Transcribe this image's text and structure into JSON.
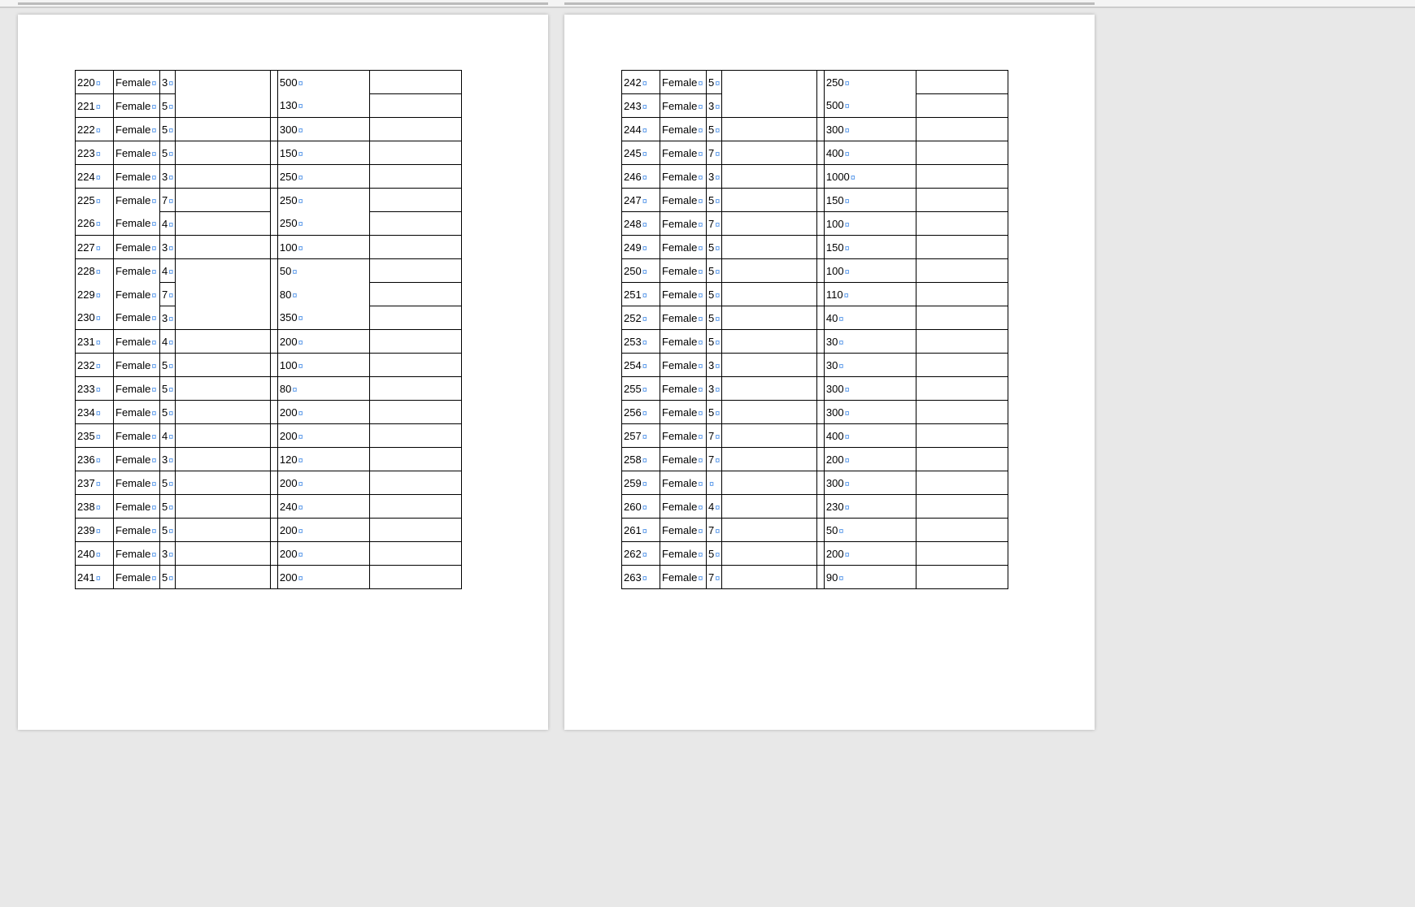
{
  "formatting_mark": "¤",
  "pages": [
    {
      "rows": [
        {
          "id": "220",
          "gender": "Female",
          "n": "3",
          "val": "500",
          "gaps": [
            3,
            4,
            5
          ]
        },
        {
          "id": "221",
          "gender": "Female",
          "n": "5",
          "val": "130"
        },
        {
          "id": "222",
          "gender": "Female",
          "n": "5",
          "val": "300"
        },
        {
          "id": "223",
          "gender": "Female",
          "n": "5",
          "val": "150"
        },
        {
          "id": "224",
          "gender": "Female",
          "n": "3",
          "val": "250"
        },
        {
          "id": "225",
          "gender": "Female",
          "n": "7",
          "val": "250",
          "gaps": [
            0,
            1,
            4,
            5
          ]
        },
        {
          "id": "226",
          "gender": "Female",
          "n": "4",
          "val": "250"
        },
        {
          "id": "227",
          "gender": "Female",
          "n": "3",
          "val": "100"
        },
        {
          "id": "228",
          "gender": "Female",
          "n": "4",
          "val": "50",
          "gaps": [
            0,
            1,
            3,
            4,
            5
          ]
        },
        {
          "id": "229",
          "gender": "Female",
          "n": "7",
          "val": "80",
          "gaps": [
            0,
            1,
            3,
            4,
            5
          ]
        },
        {
          "id": "230",
          "gender": "Female",
          "n": "3",
          "val": "350"
        },
        {
          "id": "231",
          "gender": "Female",
          "n": "4",
          "val": "200"
        },
        {
          "id": "232",
          "gender": "Female",
          "n": "5",
          "val": "100"
        },
        {
          "id": "233",
          "gender": "Female",
          "n": "5",
          "val": "80"
        },
        {
          "id": "234",
          "gender": "Female",
          "n": "5",
          "val": "200"
        },
        {
          "id": "235",
          "gender": "Female",
          "n": "4",
          "val": "200"
        },
        {
          "id": "236",
          "gender": "Female",
          "n": "3",
          "val": "120"
        },
        {
          "id": "237",
          "gender": "Female",
          "n": "5",
          "val": "200"
        },
        {
          "id": "238",
          "gender": "Female",
          "n": "5",
          "val": "240"
        },
        {
          "id": "239",
          "gender": "Female",
          "n": "5",
          "val": "200"
        },
        {
          "id": "240",
          "gender": "Female",
          "n": "3",
          "val": "200"
        },
        {
          "id": "241",
          "gender": "Female",
          "n": "5",
          "val": "200"
        }
      ]
    },
    {
      "rows": [
        {
          "id": "242",
          "gender": "Female",
          "n": "5",
          "val": "250",
          "gaps": [
            3,
            4,
            5
          ]
        },
        {
          "id": "243",
          "gender": "Female",
          "n": "3",
          "val": "500"
        },
        {
          "id": "244",
          "gender": "Female",
          "n": "5",
          "val": "300"
        },
        {
          "id": "245",
          "gender": "Female",
          "n": "7",
          "val": "400"
        },
        {
          "id": "246",
          "gender": "Female",
          "n": "3",
          "val": "1000"
        },
        {
          "id": "247",
          "gender": "Female",
          "n": "5",
          "val": "150"
        },
        {
          "id": "248",
          "gender": "Female",
          "n": "7",
          "val": "100"
        },
        {
          "id": "249",
          "gender": "Female",
          "n": "5",
          "val": "150"
        },
        {
          "id": "250",
          "gender": "Female",
          "n": "5",
          "val": "100"
        },
        {
          "id": "251",
          "gender": "Female",
          "n": "5",
          "val": "110"
        },
        {
          "id": "252",
          "gender": "Female",
          "n": "5",
          "val": "40",
          "gapsTop": [
            0,
            1
          ]
        },
        {
          "id": "253",
          "gender": "Female",
          "n": "5",
          "val": "30"
        },
        {
          "id": "254",
          "gender": "Female",
          "n": "3",
          "val": "30"
        },
        {
          "id": "255",
          "gender": "Female",
          "n": "3",
          "val": "300"
        },
        {
          "id": "256",
          "gender": "Female",
          "n": "5",
          "val": "300"
        },
        {
          "id": "257",
          "gender": "Female",
          "n": "7",
          "val": "400"
        },
        {
          "id": "258",
          "gender": "Female",
          "n": "7",
          "val": "200"
        },
        {
          "id": "259",
          "gender": "Female",
          "n": "",
          "val": "300"
        },
        {
          "id": "260",
          "gender": "Female",
          "n": "4",
          "val": "230"
        },
        {
          "id": "261",
          "gender": "Female",
          "n": "7",
          "val": "50"
        },
        {
          "id": "262",
          "gender": "Female",
          "n": "5",
          "val": "200"
        },
        {
          "id": "263",
          "gender": "Female",
          "n": "7",
          "val": "90"
        }
      ]
    }
  ]
}
